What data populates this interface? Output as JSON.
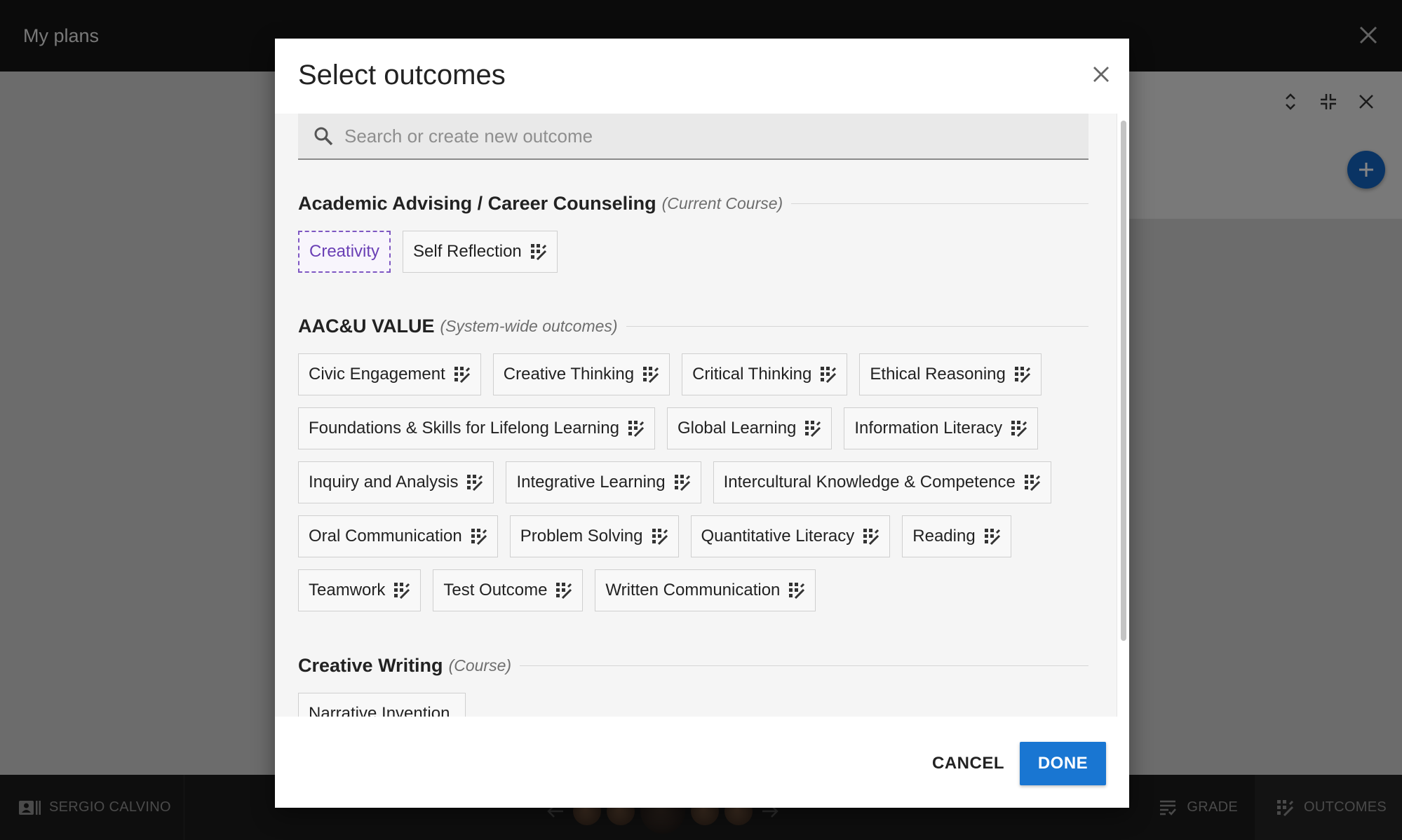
{
  "app": {
    "title": "My plans",
    "close_icon": "close-icon",
    "student_name": "SERGIO CALVINO",
    "tabs": [
      {
        "label": "GRADE",
        "icon": "grade-icon"
      },
      {
        "label": "OUTCOMES",
        "icon": "outcomes-icon"
      }
    ],
    "accent": "#1565c0"
  },
  "dialog": {
    "title": "Select outcomes",
    "search_placeholder": "Search or create new outcome",
    "search_value": "",
    "sections": [
      {
        "name": "Academic Advising / Career Counseling",
        "sub": "(Current Course)",
        "outcomes": [
          "Creativity",
          "Self Reflection"
        ]
      },
      {
        "name": "AAC&U VALUE",
        "sub": "(System-wide outcomes)",
        "outcomes": [
          "Civic Engagement",
          "Creative Thinking",
          "Critical Thinking",
          "Ethical Reasoning",
          "Foundations & Skills for Lifelong Learning",
          "Global Learning",
          "Information Literacy",
          "Inquiry and Analysis",
          "Integrative Learning",
          "Intercultural Knowledge & Competence",
          "Oral Communication",
          "Problem Solving",
          "Quantitative Literacy",
          "Reading",
          "Teamwork",
          "Test Outcome",
          "Written Communication"
        ]
      },
      {
        "name": "Creative Writing",
        "sub": "(Course)",
        "outcomes": [
          "Narrative Invention"
        ]
      }
    ],
    "selected_outcome": "Creativity",
    "cancel_label": "CANCEL",
    "done_label": "DONE",
    "selection_color": "#7e57c2",
    "primary_color": "#1976d2"
  }
}
